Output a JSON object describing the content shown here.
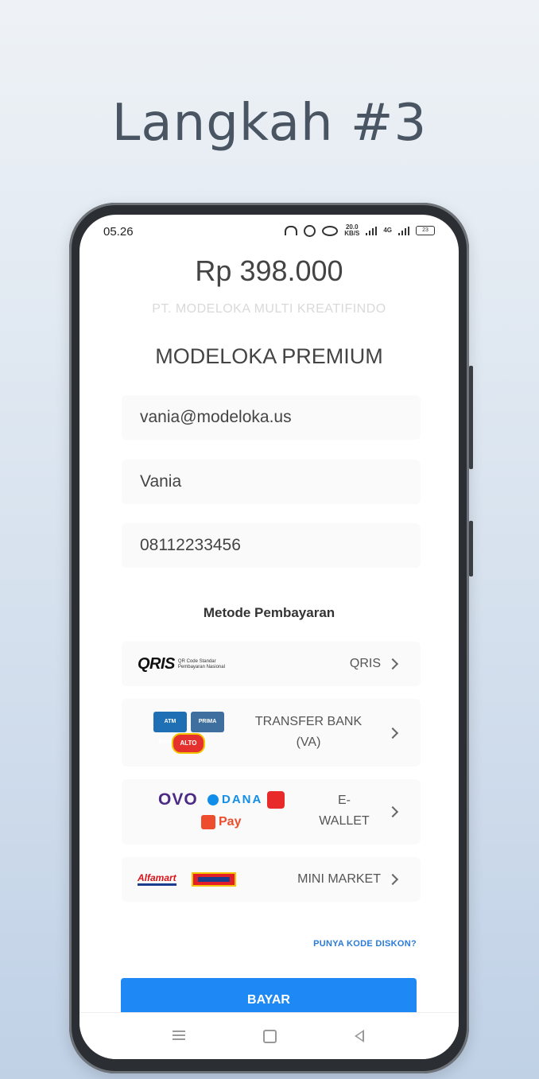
{
  "headline": "Langkah #3",
  "status": {
    "time": "05.26",
    "speed_top": "20.0",
    "speed_bottom": "KB/S",
    "network": "4G",
    "battery": "23"
  },
  "checkout": {
    "amount": "Rp 398.000",
    "company": "PT. MODELOKA MULTI KREATIFINDO",
    "product": "MODELOKA PREMIUM"
  },
  "form": {
    "email": "vania@modeloka.us",
    "name": "Vania",
    "phone": "08112233456"
  },
  "payment": {
    "section_label": "Metode Pembayaran",
    "methods": [
      {
        "label": "QRIS",
        "logo_text": "QRIS",
        "logo_sub_1": "QR Code Standar",
        "logo_sub_2": "Pembayaran Nasional"
      },
      {
        "label_1": "TRANSFER BANK",
        "label_2": "(VA)",
        "logos": [
          "ATM Bersama",
          "PRIMA",
          "ALTO"
        ]
      },
      {
        "label_1": "E-",
        "label_2": "WALLET",
        "logos": [
          "OVO",
          "DANA",
          "LinkAja",
          "Pay"
        ]
      },
      {
        "label": "MINI MARKET",
        "logos": [
          "Alfamart",
          "Indomaret"
        ]
      }
    ]
  },
  "discount_link": "PUNYA KODE DISKON?",
  "pay_button": "BAYAR",
  "colors": {
    "accent": "#1e88f5",
    "link": "#2a7bd8",
    "headline": "#4a5563"
  },
  "icons": [
    "headset-icon",
    "alarm-icon",
    "eye-icon",
    "signal-icon",
    "battery-icon",
    "chevron-right-icon",
    "nav-menu-icon",
    "nav-home-icon",
    "nav-back-icon"
  ]
}
